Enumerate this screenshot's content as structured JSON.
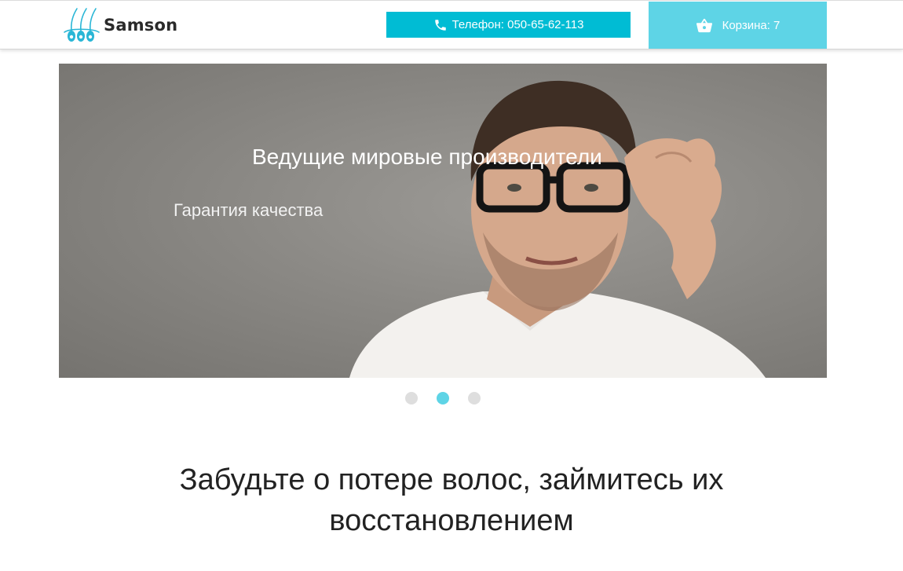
{
  "header": {
    "logo_text": "Samson",
    "phone_label": "Телефон: 050-65-62-113",
    "cart_label": "Корзина: 7"
  },
  "hero": {
    "title": "Ведущие мировые производители",
    "subtitle": "Гарантия качества",
    "slides_count": 3,
    "active_slide": 2
  },
  "main": {
    "headline_line1": "Забудьте о потере волос, займитесь их",
    "headline_line2": "восстановлением"
  },
  "colors": {
    "accent": "#00bcd4",
    "cart": "#5ed4e6",
    "dot_inactive": "#dedede"
  },
  "icons": [
    "phone-icon",
    "basket-icon",
    "logo-hair-icon"
  ]
}
